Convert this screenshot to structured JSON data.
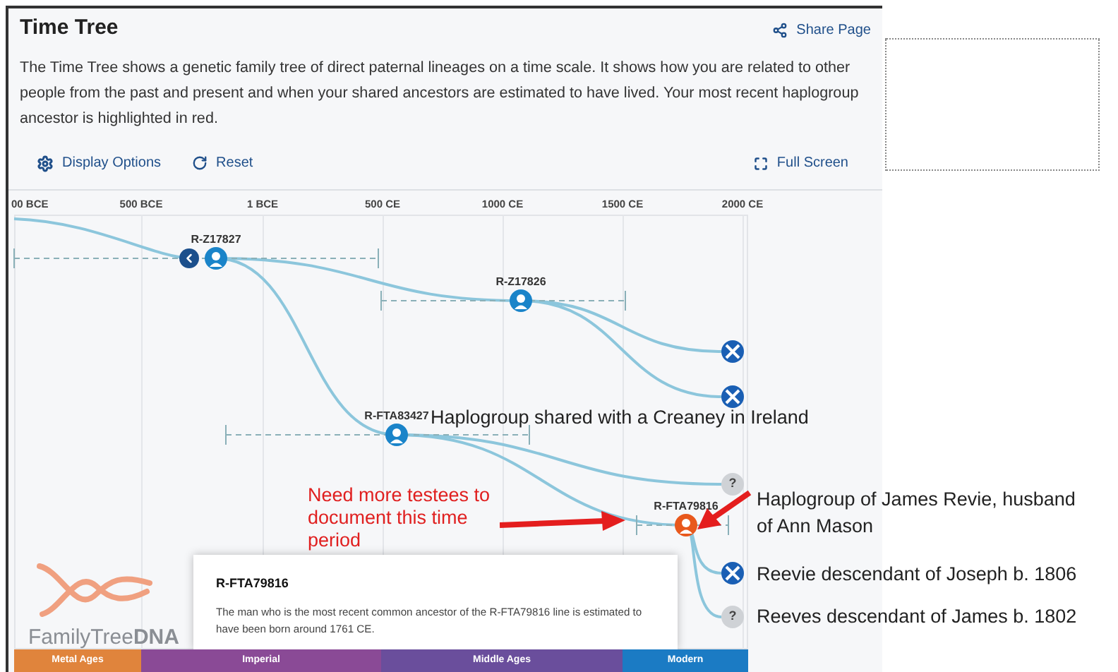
{
  "title": "Time Tree",
  "share": "Share Page",
  "description": "The Time Tree shows a genetic family tree of direct paternal lineages on a time scale. It shows how you are related to other people from the past and present and when your shared ancestors are estimated to have lived. Your most recent haplogroup ancestor is highlighted in red.",
  "toolbar": {
    "display_options": "Display Options",
    "reset": "Reset",
    "full_screen": "Full Screen"
  },
  "axis_labels": [
    "00 BCE",
    "500 BCE",
    "1 BCE",
    "500 CE",
    "1000 CE",
    "1500 CE",
    "2000 CE"
  ],
  "nodes": [
    {
      "label": "R-Z17827",
      "highlighted": false
    },
    {
      "label": "R-Z17826",
      "highlighted": false
    },
    {
      "label": "R-FTA83427",
      "highlighted": false
    },
    {
      "label": "R-FTA79816",
      "highlighted": true
    }
  ],
  "leaves": [
    {
      "kind": "flag"
    },
    {
      "kind": "flag"
    },
    {
      "kind": "unknown",
      "label": "?"
    },
    {
      "kind": "flag"
    },
    {
      "kind": "unknown",
      "label": "?"
    }
  ],
  "eras": [
    {
      "label": "Metal Ages",
      "color": "#e0843c"
    },
    {
      "label": "Imperial",
      "color": "#8a4a96"
    },
    {
      "label": "Middle Ages",
      "color": "#6a4e9c"
    },
    {
      "label": "Modern",
      "color": "#1b7bc4"
    }
  ],
  "logo": {
    "text": "FamilyTree**DNA**"
  },
  "popup": {
    "title": "R-FTA79816",
    "text": "The man who is the most recent common ancestor of the R-FTA79816 line is estimated to have been born around 1761 CE."
  },
  "annotations": {
    "creaney": "Haplogroup shared with a Creaney in Ireland",
    "testees": "Need more testees to document this time period",
    "revie": "Haplogroup of James Revie, husband of Ann Mason",
    "reevie": "Reevie descendant of Joseph b. 1806",
    "reeves": "Reeves descendant of James b. 1802"
  }
}
